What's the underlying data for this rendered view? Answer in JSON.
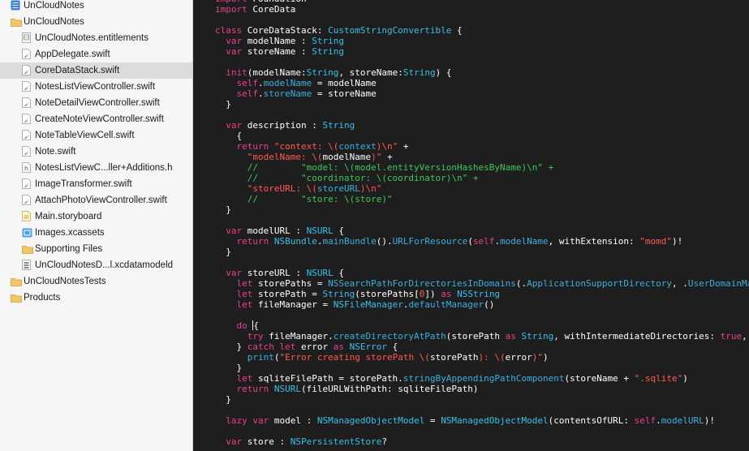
{
  "navigator": {
    "items": [
      {
        "label": "UnCloudNotes",
        "kind": "project",
        "indent": 0,
        "disclosure": "",
        "selected": false
      },
      {
        "label": "UnCloudNotes",
        "kind": "folder",
        "indent": 0,
        "disclosure": "▼",
        "selected": false
      },
      {
        "label": "UnCloudNotes.entitlements",
        "kind": "entitlements",
        "indent": 1,
        "disclosure": "",
        "selected": false
      },
      {
        "label": "AppDelegate.swift",
        "kind": "swift",
        "indent": 1,
        "disclosure": "",
        "selected": false
      },
      {
        "label": "CoreDataStack.swift",
        "kind": "swift",
        "indent": 1,
        "disclosure": "",
        "selected": true
      },
      {
        "label": "NotesListViewController.swift",
        "kind": "swift",
        "indent": 1,
        "disclosure": "",
        "selected": false
      },
      {
        "label": "NoteDetailViewController.swift",
        "kind": "swift",
        "indent": 1,
        "disclosure": "",
        "selected": false
      },
      {
        "label": "CreateNoteViewController.swift",
        "kind": "swift",
        "indent": 1,
        "disclosure": "",
        "selected": false
      },
      {
        "label": "NoteTableViewCell.swift",
        "kind": "swift",
        "indent": 1,
        "disclosure": "",
        "selected": false
      },
      {
        "label": "Note.swift",
        "kind": "swift",
        "indent": 1,
        "disclosure": "",
        "selected": false
      },
      {
        "label": "NotesListViewC...ller+Additions.h",
        "kind": "header",
        "indent": 1,
        "disclosure": "",
        "selected": false
      },
      {
        "label": "ImageTransformer.swift",
        "kind": "swift",
        "indent": 1,
        "disclosure": "",
        "selected": false
      },
      {
        "label": "AttachPhotoViewController.swift",
        "kind": "swift",
        "indent": 1,
        "disclosure": "",
        "selected": false
      },
      {
        "label": "Main.storyboard",
        "kind": "storyboard",
        "indent": 1,
        "disclosure": "",
        "selected": false
      },
      {
        "label": "Images.xcassets",
        "kind": "xcassets",
        "indent": 1,
        "disclosure": "",
        "selected": false
      },
      {
        "label": "Supporting Files",
        "kind": "folder",
        "indent": 1,
        "disclosure": "▶",
        "selected": false
      },
      {
        "label": "UnCloudNotesD...l.xcdatamodeld",
        "kind": "datamodel",
        "indent": 1,
        "disclosure": "",
        "selected": false
      },
      {
        "label": "UnCloudNotesTests",
        "kind": "folder",
        "indent": 0,
        "disclosure": "▶",
        "selected": false
      },
      {
        "label": "Products",
        "kind": "folder",
        "indent": 0,
        "disclosure": "▶",
        "selected": false
      }
    ]
  },
  "editor": {
    "lines": [
      [
        [
          "kw",
          "import"
        ],
        [
          "p",
          " Foundation"
        ]
      ],
      [
        [
          "kw",
          "import"
        ],
        [
          "p",
          " CoreData"
        ]
      ],
      [],
      [
        [
          "kw",
          "class"
        ],
        [
          "p",
          " CoreDataStack: "
        ],
        [
          "ty",
          "CustomStringConvertible"
        ],
        [
          "p",
          " {"
        ]
      ],
      [
        [
          "p",
          "  "
        ],
        [
          "kw",
          "var"
        ],
        [
          "p",
          " modelName : "
        ],
        [
          "ty",
          "String"
        ]
      ],
      [
        [
          "p",
          "  "
        ],
        [
          "kw",
          "var"
        ],
        [
          "p",
          " storeName : "
        ],
        [
          "ty",
          "String"
        ]
      ],
      [],
      [
        [
          "p",
          "  "
        ],
        [
          "kw",
          "init"
        ],
        [
          "p",
          "(modelName:"
        ],
        [
          "ty",
          "String"
        ],
        [
          "p",
          ", storeName:"
        ],
        [
          "ty",
          "String"
        ],
        [
          "p",
          ") {"
        ]
      ],
      [
        [
          "p",
          "    "
        ],
        [
          "kw",
          "self"
        ],
        [
          "p",
          "."
        ],
        [
          "fn",
          "modelName"
        ],
        [
          "p",
          " = modelName"
        ]
      ],
      [
        [
          "p",
          "    "
        ],
        [
          "kw",
          "self"
        ],
        [
          "p",
          "."
        ],
        [
          "fn",
          "storeName"
        ],
        [
          "p",
          " = storeName"
        ]
      ],
      [
        [
          "p",
          "  }"
        ]
      ],
      [],
      [
        [
          "p",
          "  "
        ],
        [
          "kw",
          "var"
        ],
        [
          "p",
          " description : "
        ],
        [
          "ty",
          "String"
        ]
      ],
      [
        [
          "p",
          "    {"
        ]
      ],
      [
        [
          "p",
          "    "
        ],
        [
          "kw",
          "return"
        ],
        [
          "p",
          " "
        ],
        [
          "st",
          "\"context: \\("
        ],
        [
          "fn",
          "context"
        ],
        [
          "st",
          ")\\n\""
        ],
        [
          "p",
          " +"
        ]
      ],
      [
        [
          "p",
          "      "
        ],
        [
          "st",
          "\"modelName: \\("
        ],
        [
          "p",
          "modelName"
        ],
        [
          "st",
          ")\""
        ],
        [
          "p",
          " +"
        ]
      ],
      [
        [
          "p",
          "      "
        ],
        [
          "cm",
          "//        \"model: \\(model.entityVersionHashesByName)\\n\" +"
        ]
      ],
      [
        [
          "p",
          "      "
        ],
        [
          "cm",
          "//        \"coordinator: \\(coordinator)\\n\" +"
        ]
      ],
      [
        [
          "p",
          "      "
        ],
        [
          "st",
          "\"storeURL: \\("
        ],
        [
          "fn",
          "storeURL"
        ],
        [
          "st",
          ")\\n\""
        ]
      ],
      [
        [
          "p",
          "      "
        ],
        [
          "cm",
          "//        \"store: \\(store)\""
        ]
      ],
      [
        [
          "p",
          "  }"
        ]
      ],
      [],
      [
        [
          "p",
          "  "
        ],
        [
          "kw",
          "var"
        ],
        [
          "p",
          " modelURL : "
        ],
        [
          "ty",
          "NSURL"
        ],
        [
          "p",
          " {"
        ]
      ],
      [
        [
          "p",
          "    "
        ],
        [
          "kw",
          "return"
        ],
        [
          "p",
          " "
        ],
        [
          "ty",
          "NSBundle"
        ],
        [
          "p",
          "."
        ],
        [
          "fn",
          "mainBundle"
        ],
        [
          "p",
          "()."
        ],
        [
          "fn",
          "URLForResource"
        ],
        [
          "p",
          "("
        ],
        [
          "kw",
          "self"
        ],
        [
          "p",
          "."
        ],
        [
          "fn",
          "modelName"
        ],
        [
          "p",
          ", withExtension: "
        ],
        [
          "st",
          "\"momd\""
        ],
        [
          "p",
          ")!"
        ]
      ],
      [
        [
          "p",
          "  }"
        ]
      ],
      [],
      [
        [
          "p",
          "  "
        ],
        [
          "kw",
          "var"
        ],
        [
          "p",
          " storeURL : "
        ],
        [
          "ty",
          "NSURL"
        ],
        [
          "p",
          " {"
        ]
      ],
      [
        [
          "p",
          "    "
        ],
        [
          "kw",
          "let"
        ],
        [
          "p",
          " storePaths = "
        ],
        [
          "fn",
          "NSSearchPathForDirectoriesInDomains"
        ],
        [
          "p",
          "(."
        ],
        [
          "fn",
          "ApplicationSupportDirectory"
        ],
        [
          "p",
          ", ."
        ],
        [
          "fn",
          "UserDomainMa"
        ]
      ],
      [
        [
          "p",
          "    "
        ],
        [
          "kw",
          "let"
        ],
        [
          "p",
          " storePath = "
        ],
        [
          "ty",
          "String"
        ],
        [
          "p",
          "(storePaths["
        ],
        [
          "st",
          "0"
        ],
        [
          "p",
          "]) "
        ],
        [
          "kw",
          "as"
        ],
        [
          "p",
          " "
        ],
        [
          "ty",
          "NSString"
        ]
      ],
      [
        [
          "p",
          "    "
        ],
        [
          "kw",
          "let"
        ],
        [
          "p",
          " fileManager = "
        ],
        [
          "ty",
          "NSFileManager"
        ],
        [
          "p",
          "."
        ],
        [
          "fn",
          "defaultManager"
        ],
        [
          "p",
          "()"
        ]
      ],
      [],
      [
        [
          "p",
          "    "
        ],
        [
          "kw",
          "do"
        ],
        [
          "p",
          " "
        ],
        [
          "cursor",
          ""
        ],
        [
          "p",
          "{"
        ]
      ],
      [
        [
          "p",
          "      "
        ],
        [
          "kw",
          "try"
        ],
        [
          "p",
          " fileManager."
        ],
        [
          "fn",
          "createDirectoryAtPath"
        ],
        [
          "p",
          "(storePath "
        ],
        [
          "kw",
          "as"
        ],
        [
          "p",
          " "
        ],
        [
          "ty",
          "String"
        ],
        [
          "p",
          ", withIntermediateDirectories: "
        ],
        [
          "kw",
          "true"
        ],
        [
          "p",
          ","
        ]
      ],
      [
        [
          "p",
          "    } "
        ],
        [
          "kw",
          "catch"
        ],
        [
          "p",
          " "
        ],
        [
          "kw",
          "let"
        ],
        [
          "p",
          " error "
        ],
        [
          "kw",
          "as"
        ],
        [
          "p",
          " "
        ],
        [
          "ty",
          "NSError"
        ],
        [
          "p",
          " {"
        ]
      ],
      [
        [
          "p",
          "      "
        ],
        [
          "fn",
          "print"
        ],
        [
          "p",
          "("
        ],
        [
          "st",
          "\"Error creating storePath \\("
        ],
        [
          "p",
          "storePath"
        ],
        [
          "st",
          "): \\("
        ],
        [
          "p",
          "error"
        ],
        [
          "st",
          ")\""
        ],
        [
          "p",
          ")"
        ]
      ],
      [
        [
          "p",
          "    }"
        ]
      ],
      [
        [
          "p",
          "    "
        ],
        [
          "kw",
          "let"
        ],
        [
          "p",
          " sqliteFilePath = storePath."
        ],
        [
          "fn",
          "stringByAppendingPathComponent"
        ],
        [
          "p",
          "(storeName + "
        ],
        [
          "st",
          "\".sqlite\""
        ],
        [
          "p",
          ")"
        ]
      ],
      [
        [
          "p",
          "    "
        ],
        [
          "kw",
          "return"
        ],
        [
          "p",
          " "
        ],
        [
          "ty",
          "NSURL"
        ],
        [
          "p",
          "(fileURLWithPath: sqliteFilePath)"
        ]
      ],
      [
        [
          "p",
          "  }"
        ]
      ],
      [],
      [
        [
          "p",
          "  "
        ],
        [
          "kw",
          "lazy"
        ],
        [
          "p",
          " "
        ],
        [
          "kw",
          "var"
        ],
        [
          "p",
          " model : "
        ],
        [
          "ty",
          "NSManagedObjectModel"
        ],
        [
          "p",
          " = "
        ],
        [
          "ty",
          "NSManagedObjectModel"
        ],
        [
          "p",
          "(contentsOfURL: "
        ],
        [
          "kw",
          "self"
        ],
        [
          "p",
          "."
        ],
        [
          "fn",
          "modelURL"
        ],
        [
          "p",
          ")!"
        ]
      ],
      [],
      [
        [
          "p",
          "  "
        ],
        [
          "kw",
          "var"
        ],
        [
          "p",
          " store : "
        ],
        [
          "ty",
          "NSPersistentStore"
        ],
        [
          "p",
          "?"
        ]
      ]
    ]
  }
}
